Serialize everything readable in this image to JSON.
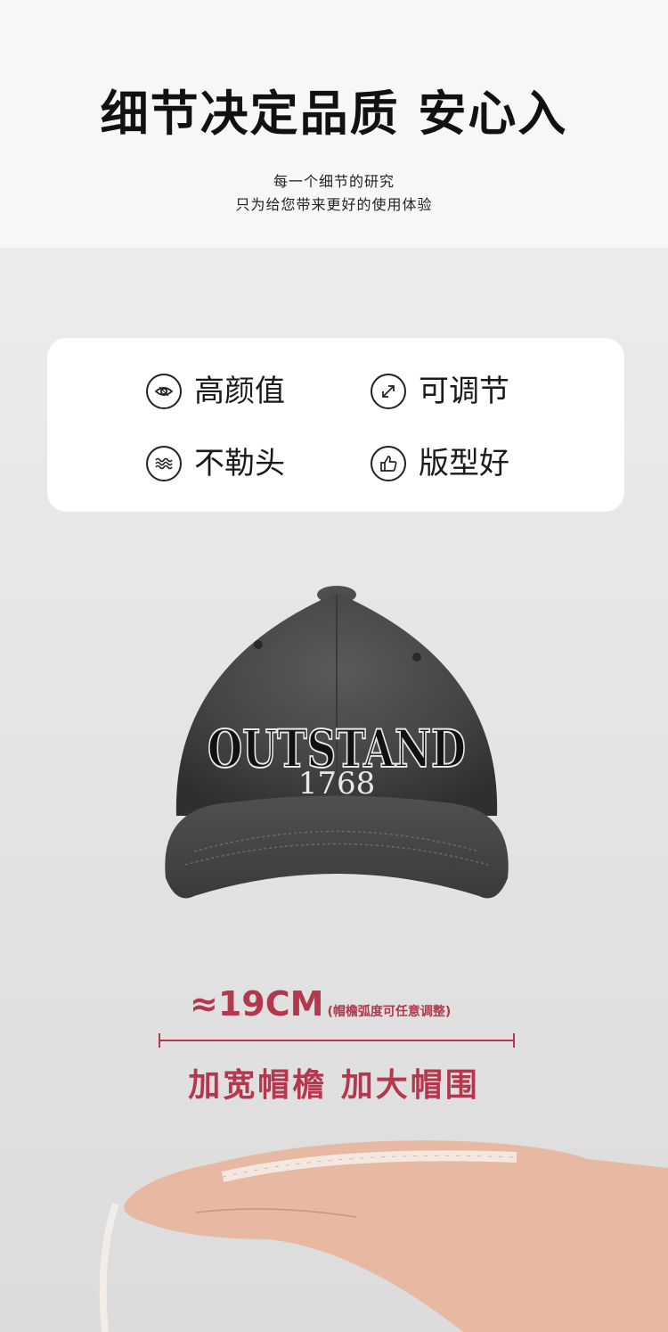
{
  "header": {
    "title": "细节决定品质 安心入",
    "sub_line1": "每一个细节的研究",
    "sub_line2": "只为给您带来更好的使用体验"
  },
  "features": [
    {
      "label": "高颜值",
      "icon": "eye-icon"
    },
    {
      "label": "可调节",
      "icon": "resize-arrows-icon"
    },
    {
      "label": "不勒头",
      "icon": "waves-icon"
    },
    {
      "label": "版型好",
      "icon": "thumbs-up-icon"
    }
  ],
  "cap": {
    "text_main": "OUTSTAND",
    "text_year": "1768"
  },
  "measure": {
    "value": "≈19CM",
    "note": "(帽檐弧度可任意调整)",
    "headline": "加宽帽檐 加大帽围"
  },
  "colors": {
    "accent": "#b3384d",
    "cap_body": "#4a4a4a",
    "header_bg": "#f7f7f7",
    "card_bg": "#ffffff"
  }
}
